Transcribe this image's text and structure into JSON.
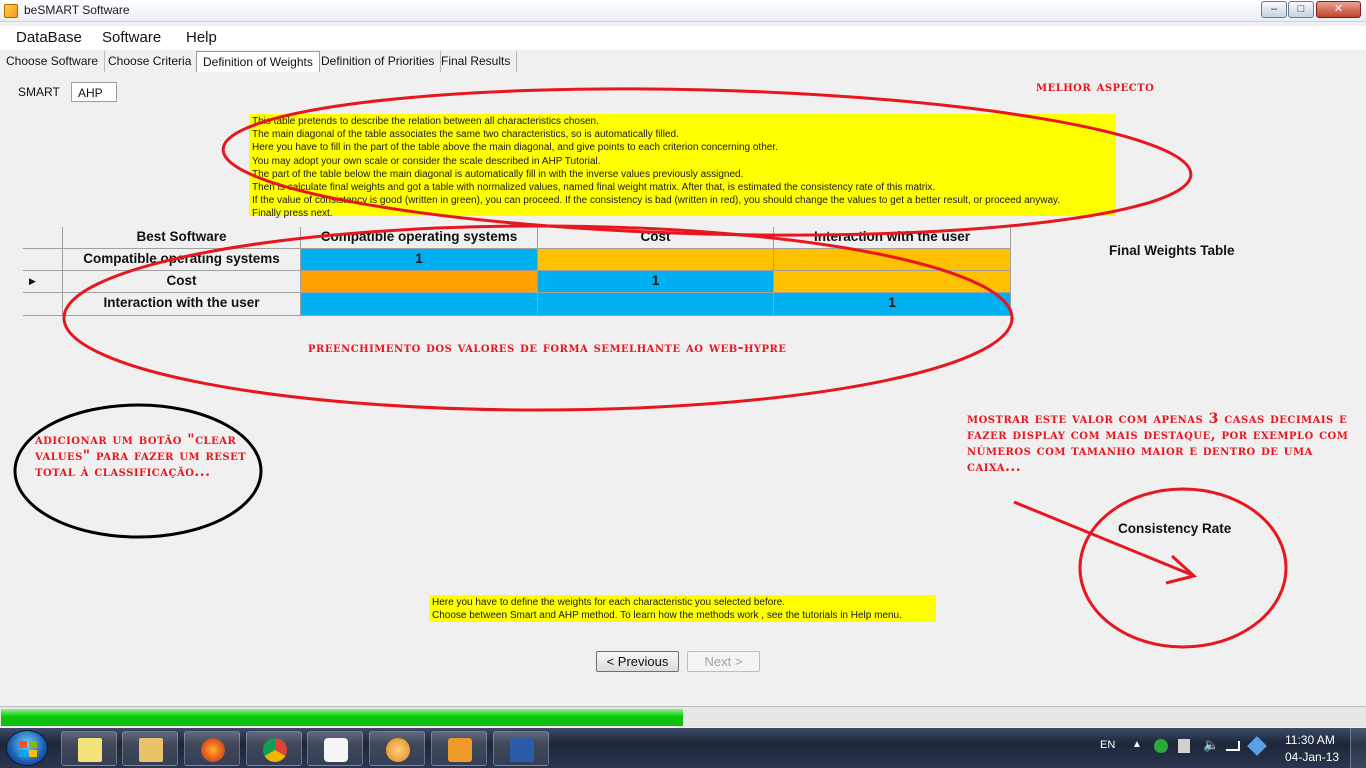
{
  "window": {
    "title": "beSMART Software",
    "controls": [
      "minimize",
      "maximize",
      "close"
    ]
  },
  "menu": [
    "DataBase",
    "Software",
    "Help"
  ],
  "tabs": [
    {
      "label": "Choose Software",
      "active": false
    },
    {
      "label": "Choose Criteria",
      "active": false
    },
    {
      "label": "Definition of Weights",
      "active": true
    },
    {
      "label": "Definition of Priorities",
      "active": false
    },
    {
      "label": "Final Results",
      "active": false
    }
  ],
  "method_tabs": [
    {
      "label": "SMART",
      "active": false
    },
    {
      "label": "AHP",
      "active": true
    }
  ],
  "instructions": [
    "This table pretends to describe the relation between all characteristics chosen.",
    "The main diagonal of the table associates the same two characteristics, so  is automatically filled.",
    "Here you have to  fill in the part of the table above the main diagonal, and give points to each criterion concerning other.",
    "You may adopt your own scale or consider  the scale described in AHP Tutorial.",
    "The part of the table below the main diagonal is automatically fill in  with the inverse values previously assigned.",
    "Then is calculate final weights and got a  table with normalized values, named final weight matrix. After that, is estimated the consistency rate of  this matrix.",
    "If the value of consistency is good (written in green), you can proceed. If the consistency is bad (written in red), you should change the values to get a better result, or proceed anyway.",
    "Finally press next."
  ],
  "matrix": {
    "corner_label": "Best Software",
    "columns": [
      "Compatible operating systems",
      "Cost",
      "Interaction with the user"
    ],
    "rows": [
      {
        "label": "Compatible operating systems",
        "cells": [
          "1",
          "",
          ""
        ],
        "selected": false
      },
      {
        "label": "Cost",
        "cells": [
          "",
          "1",
          ""
        ],
        "selected": true
      },
      {
        "label": "Interaction with the user",
        "cells": [
          "",
          "",
          "1"
        ],
        "selected": false
      }
    ]
  },
  "final_weights_label": "Final Weights Table",
  "consistency_label": "Consistency Rate",
  "help_text": [
    "Here you have to define the weights for each characteristic you selected before.",
    "Choose between Smart and AHP method. To learn how the methods work , see the tutorials in Help menu."
  ],
  "buttons": {
    "previous": "< Previous",
    "next": "Next >",
    "next_enabled": false
  },
  "progress": 0.5,
  "annotations": {
    "melhor_aspecto": "melhor aspecto",
    "preenchimento": "preenchimento dos valores de forma semelhante ao web-hypre",
    "adicionar": "adicionar um botão \"clear values\" para fazer um reset total à classificação...",
    "mostrar": "mostrar este valor com apenas 3 casas decimais e fazer display com mais destaque, por exemplo com números com tamanho maior e dentro de uma caixa..."
  },
  "colors": {
    "instruction_bg": "#ffff00",
    "upper_cell": "#ffc000",
    "lower_cell_selected": "#ff9f00",
    "diagonal_cell": "#00b0f0",
    "annotation_red": "#e8161e"
  },
  "taskbar": {
    "apps": [
      "explorer-notes",
      "folder",
      "firefox",
      "chrome",
      "foobar",
      "app-orange",
      "media-player",
      "word"
    ],
    "language": "EN",
    "time": "11:30 AM",
    "date": "04-Jan-13"
  }
}
